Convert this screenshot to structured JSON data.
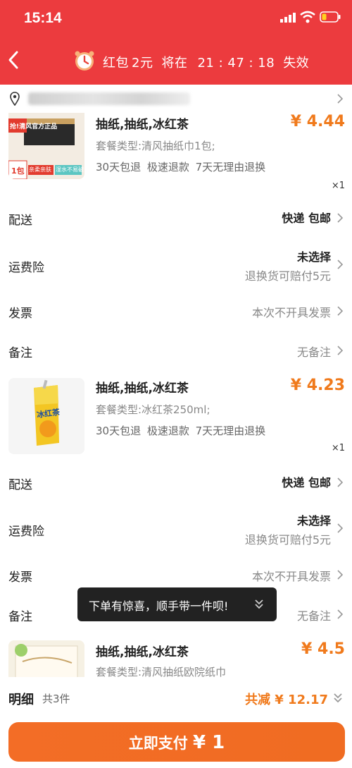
{
  "status_bar": {
    "time": "15:14"
  },
  "nav": {
    "back_icon": "chevron-left-icon",
    "hongbao_label": "红包",
    "hongbao_amount": "2元",
    "expire_prefix": "将在",
    "countdown": "21 : 47 : 18",
    "expire_suffix": "失效"
  },
  "address": {
    "icon": "location-pin-icon"
  },
  "products": [
    {
      "title": "抽纸,抽纸,冰红茶",
      "spec": "套餐类型:清风抽纸巾1包;",
      "tags": "30天包退  极速退款  7天无理由退换",
      "price": "¥ 4.44",
      "qty": "×1",
      "image_text": {
        "top": "抢!清风官方正品",
        "bottom_left": "1包",
        "bottom_mid": "亲柔亲肤",
        "bottom_right": "湿水不易破"
      }
    },
    {
      "title": "抽纸,抽纸,冰红茶",
      "spec": "套餐类型:冰红茶250ml;",
      "tags": "30天包退  极速退款  7天无理由退换",
      "price": "¥ 4.23",
      "qty": "×1",
      "image_text": {
        "brand": "冰红茶"
      }
    },
    {
      "title": "抽纸,抽纸,冰红茶",
      "spec": "套餐类型:清风抽纸欧院纸巾",
      "price": "¥ 4.5"
    }
  ],
  "order_rows": [
    {
      "delivery_label": "配送",
      "delivery_value": "快递 包邮",
      "insurance_label": "运费险",
      "insurance_value": "未选择",
      "insurance_sub": "退换货可赔付5元",
      "invoice_label": "发票",
      "invoice_value": "本次不开具发票",
      "remark_label": "备注",
      "remark_value": "无备注"
    },
    {
      "delivery_label": "配送",
      "delivery_value": "快递 包邮",
      "insurance_label": "运费险",
      "insurance_value": "未选择",
      "insurance_sub": "退换货可赔付5元",
      "invoice_label": "发票",
      "invoice_value": "本次不开具发票",
      "remark_label": "备注",
      "remark_value": "无备注"
    }
  ],
  "toast": {
    "text": "下单有惊喜，顺手带一件呗!"
  },
  "summary": {
    "label": "明细",
    "count": "共3件",
    "discount": "共减 ¥ 12.17"
  },
  "pay_button": {
    "label": "立即支付",
    "amount": "¥ 1"
  },
  "colors": {
    "header_red": "#ec3b3e",
    "price_orange": "#f07a1c",
    "pay_orange": "#f36d26"
  }
}
